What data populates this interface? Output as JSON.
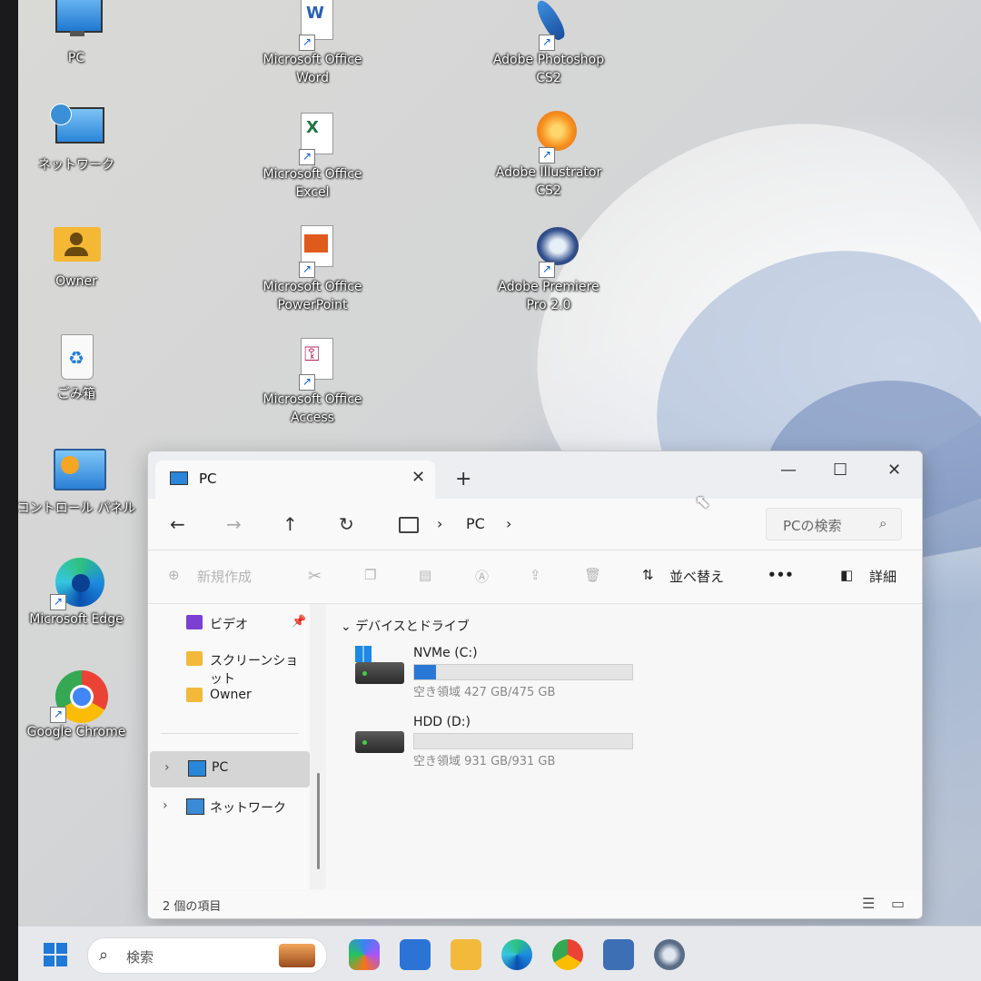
{
  "desktop": {
    "icons": [
      {
        "label": "PC",
        "icon": "pc-monitor-icon"
      },
      {
        "label": "ネットワーク",
        "icon": "network-globe-icon"
      },
      {
        "label": "Owner",
        "icon": "user-folder-icon"
      },
      {
        "label": "ごみ箱",
        "icon": "recycle-bin-icon"
      },
      {
        "label": "コントロール パネル",
        "icon": "control-panel-icon"
      },
      {
        "label": "Microsoft Edge",
        "icon": "edge-icon"
      },
      {
        "label": "Google Chrome",
        "icon": "chrome-icon"
      },
      {
        "label": "Microsoft Office\nWord",
        "icon": "word-icon"
      },
      {
        "label": "Microsoft Office\nExcel",
        "icon": "excel-icon"
      },
      {
        "label": "Microsoft Office\nPowerPoint",
        "icon": "powerpoint-icon"
      },
      {
        "label": "Microsoft Office\nAccess",
        "icon": "access-icon"
      },
      {
        "label": "Adobe Photoshop\nCS2",
        "icon": "photoshop-feather-icon"
      },
      {
        "label": "Adobe Illustrator\nCS2",
        "icon": "illustrator-flower-icon"
      },
      {
        "label": "Adobe Premiere\nPro 2.0",
        "icon": "premiere-icon"
      }
    ]
  },
  "explorer": {
    "tab_title": "PC",
    "tab_close": "✕",
    "new_tab": "+",
    "window_controls": {
      "minimize": "—",
      "maximize": "☐",
      "close": "✕"
    },
    "nav": {
      "back": "←",
      "forward": "→",
      "up": "↑",
      "refresh": "↻",
      "crumb_sep": "›",
      "crumb": "PC"
    },
    "search_placeholder": "PCの検索",
    "toolbar": {
      "new": "新規作成",
      "sort": "並べ替え",
      "more": "•••",
      "details": "詳細"
    },
    "sidebar": [
      {
        "label": "ビデオ",
        "icon": "video-icon",
        "pinned": true
      },
      {
        "label": "スクリーンショット",
        "icon": "folder-icon"
      },
      {
        "label": "Owner",
        "icon": "folder-icon"
      },
      {
        "label": "PC",
        "icon": "pc-icon",
        "selected": true
      },
      {
        "label": "ネットワーク",
        "icon": "network-icon"
      }
    ],
    "group_header": "デバイスとドライブ",
    "drives": [
      {
        "name": "NVMe (C:)",
        "free_text": "空き領域 427 GB/475 GB",
        "used_fraction": 0.1
      },
      {
        "name": "HDD (D:)",
        "free_text": "空き領域 931 GB/931 GB",
        "used_fraction": 0.0
      }
    ],
    "status": "2 個の項目"
  },
  "taskbar": {
    "search_placeholder": "検索"
  }
}
